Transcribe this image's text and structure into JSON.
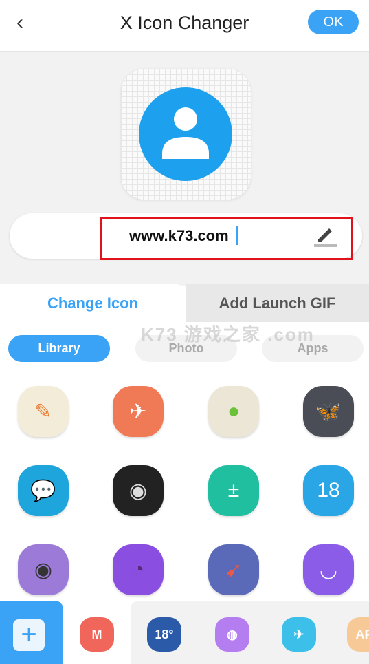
{
  "header": {
    "title": "X Icon Changer",
    "ok_label": "OK",
    "back_icon": "chevron-left-icon"
  },
  "preview": {
    "icon": "contact-person-icon",
    "color": "#1da1ee"
  },
  "name_field": {
    "value": "www.k73.com",
    "edit_icon": "pencil-icon"
  },
  "watermark": "K73 游戏之家 .com",
  "tabs": [
    {
      "label": "Change Icon",
      "active": true
    },
    {
      "label": "Add Launch GIF",
      "active": false
    }
  ],
  "sources": [
    {
      "label": "Library",
      "active": true
    },
    {
      "label": "Photo",
      "active": false
    },
    {
      "label": "Apps",
      "active": false
    }
  ],
  "library_icons": [
    {
      "name": "note-icon",
      "color": "#f3ecd9",
      "glyph": "✎",
      "fg": "#e8813a"
    },
    {
      "name": "paper-plane-icon",
      "color": "#f07a55",
      "glyph": "✈",
      "fg": "#fff"
    },
    {
      "name": "lollipop-icon",
      "color": "#ebe6d6",
      "glyph": "●",
      "fg": "#6bc23a"
    },
    {
      "name": "clapperboard-icon",
      "color": "#4a4d55",
      "glyph": "🦋",
      "fg": "#888"
    },
    {
      "name": "chat-bubble-icon",
      "color": "#1ea5dc",
      "glyph": "💬",
      "fg": "#fff"
    },
    {
      "name": "globe-browser-icon",
      "color": "#222222",
      "glyph": "◉",
      "fg": "#ddd"
    },
    {
      "name": "calculator-icon",
      "color": "#1fbf9f",
      "glyph": "±",
      "fg": "#fff"
    },
    {
      "name": "calendar-icon",
      "color": "#2aa6e6",
      "glyph": "18",
      "fg": "#fff"
    },
    {
      "name": "camera-icon",
      "color": "#9b7ad8",
      "glyph": "◉",
      "fg": "#333"
    },
    {
      "name": "clock-icon",
      "color": "#8a4fe0",
      "glyph": "◔",
      "fg": "#5a2a7a"
    },
    {
      "name": "compass-icon",
      "color": "#5a6ab8",
      "glyph": "➹",
      "fg": "#e85a4a"
    },
    {
      "name": "smiley-icon",
      "color": "#8a5ce8",
      "glyph": "◡",
      "fg": "#fff"
    }
  ],
  "bottom": {
    "add_label": "+",
    "recent_icons": [
      {
        "name": "music-headphones-icon",
        "color": "#f0665a",
        "glyph": "M"
      },
      {
        "name": "weather-icon",
        "color": "#2b5aa8",
        "glyph": "18°"
      },
      {
        "name": "planet-icon",
        "color": "#b57ef0",
        "glyph": "◍"
      },
      {
        "name": "airplane-icon",
        "color": "#3cc0ea",
        "glyph": "✈"
      },
      {
        "name": "app-peach-icon",
        "color": "#f6c996",
        "glyph": "AP"
      }
    ]
  }
}
